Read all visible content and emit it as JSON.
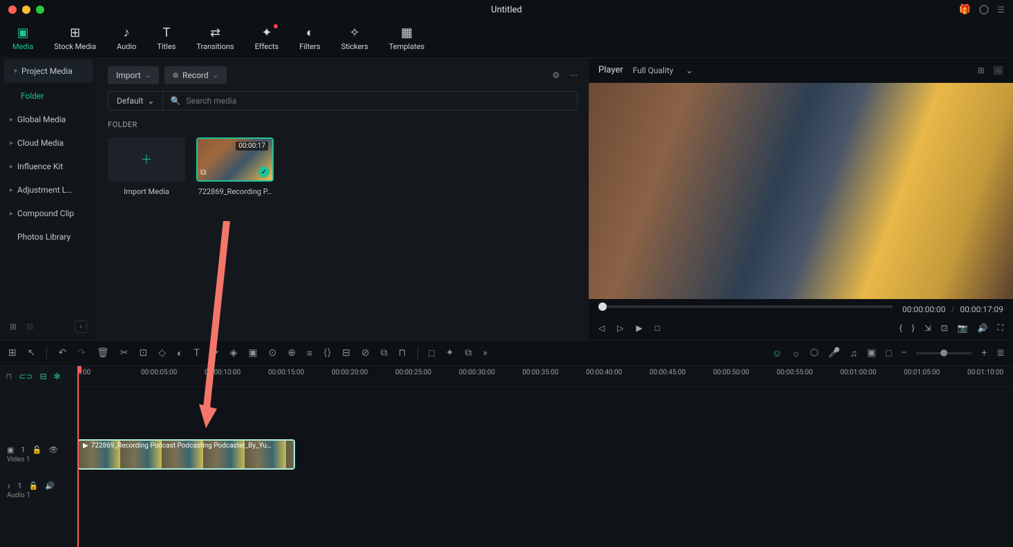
{
  "window": {
    "title": "Untitled"
  },
  "tabs": [
    {
      "label": "Media",
      "icon": "media",
      "active": true
    },
    {
      "label": "Stock Media",
      "icon": "stock"
    },
    {
      "label": "Audio",
      "icon": "audio"
    },
    {
      "label": "Titles",
      "icon": "titles"
    },
    {
      "label": "Transitions",
      "icon": "transitions"
    },
    {
      "label": "Effects",
      "icon": "effects",
      "badge": true
    },
    {
      "label": "Filters",
      "icon": "filters"
    },
    {
      "label": "Stickers",
      "icon": "stickers"
    },
    {
      "label": "Templates",
      "icon": "templates"
    }
  ],
  "sidebar": {
    "items": [
      {
        "label": "Project Media",
        "selected": true
      },
      {
        "label": "Folder",
        "folder": true
      },
      {
        "label": "Global Media"
      },
      {
        "label": "Cloud Media"
      },
      {
        "label": "Influence Kit"
      },
      {
        "label": "Adjustment L…"
      },
      {
        "label": "Compound Clip"
      },
      {
        "label": "Photos Library",
        "noChev": true
      }
    ]
  },
  "mediaPanel": {
    "import": "Import",
    "record": "Record",
    "sort": "Default",
    "searchPlaceholder": "Search media",
    "sectionLabel": "FOLDER",
    "tiles": [
      {
        "label": "Import Media",
        "type": "add"
      },
      {
        "label": "722869_Recording P…",
        "type": "clip",
        "duration": "00:00:17",
        "selected": true
      }
    ]
  },
  "player": {
    "label": "Player",
    "quality": "Full Quality",
    "current": "00:00:00:00",
    "total": "00:00:17:09"
  },
  "timeline": {
    "ticks": [
      "0:00",
      "00:00:05:00",
      "00:00:10:00",
      "00:00:15:00",
      "00:00:20:00",
      "00:00:25:00",
      "00:00:30:00",
      "00:00:35:00",
      "00:00:40:00",
      "00:00:45:00",
      "00:00:50:00",
      "00:00:55:00",
      "00:01:00:00",
      "00:01:05:00",
      "00:01:10:00"
    ],
    "tracks": [
      {
        "name": "Video 1",
        "type": "video",
        "index": "1"
      },
      {
        "name": "Audio 1",
        "type": "audio",
        "index": "1"
      }
    ],
    "clip": {
      "label": "722869_Recording Podcast Podcasting Podcaster_By_Yu…"
    }
  }
}
